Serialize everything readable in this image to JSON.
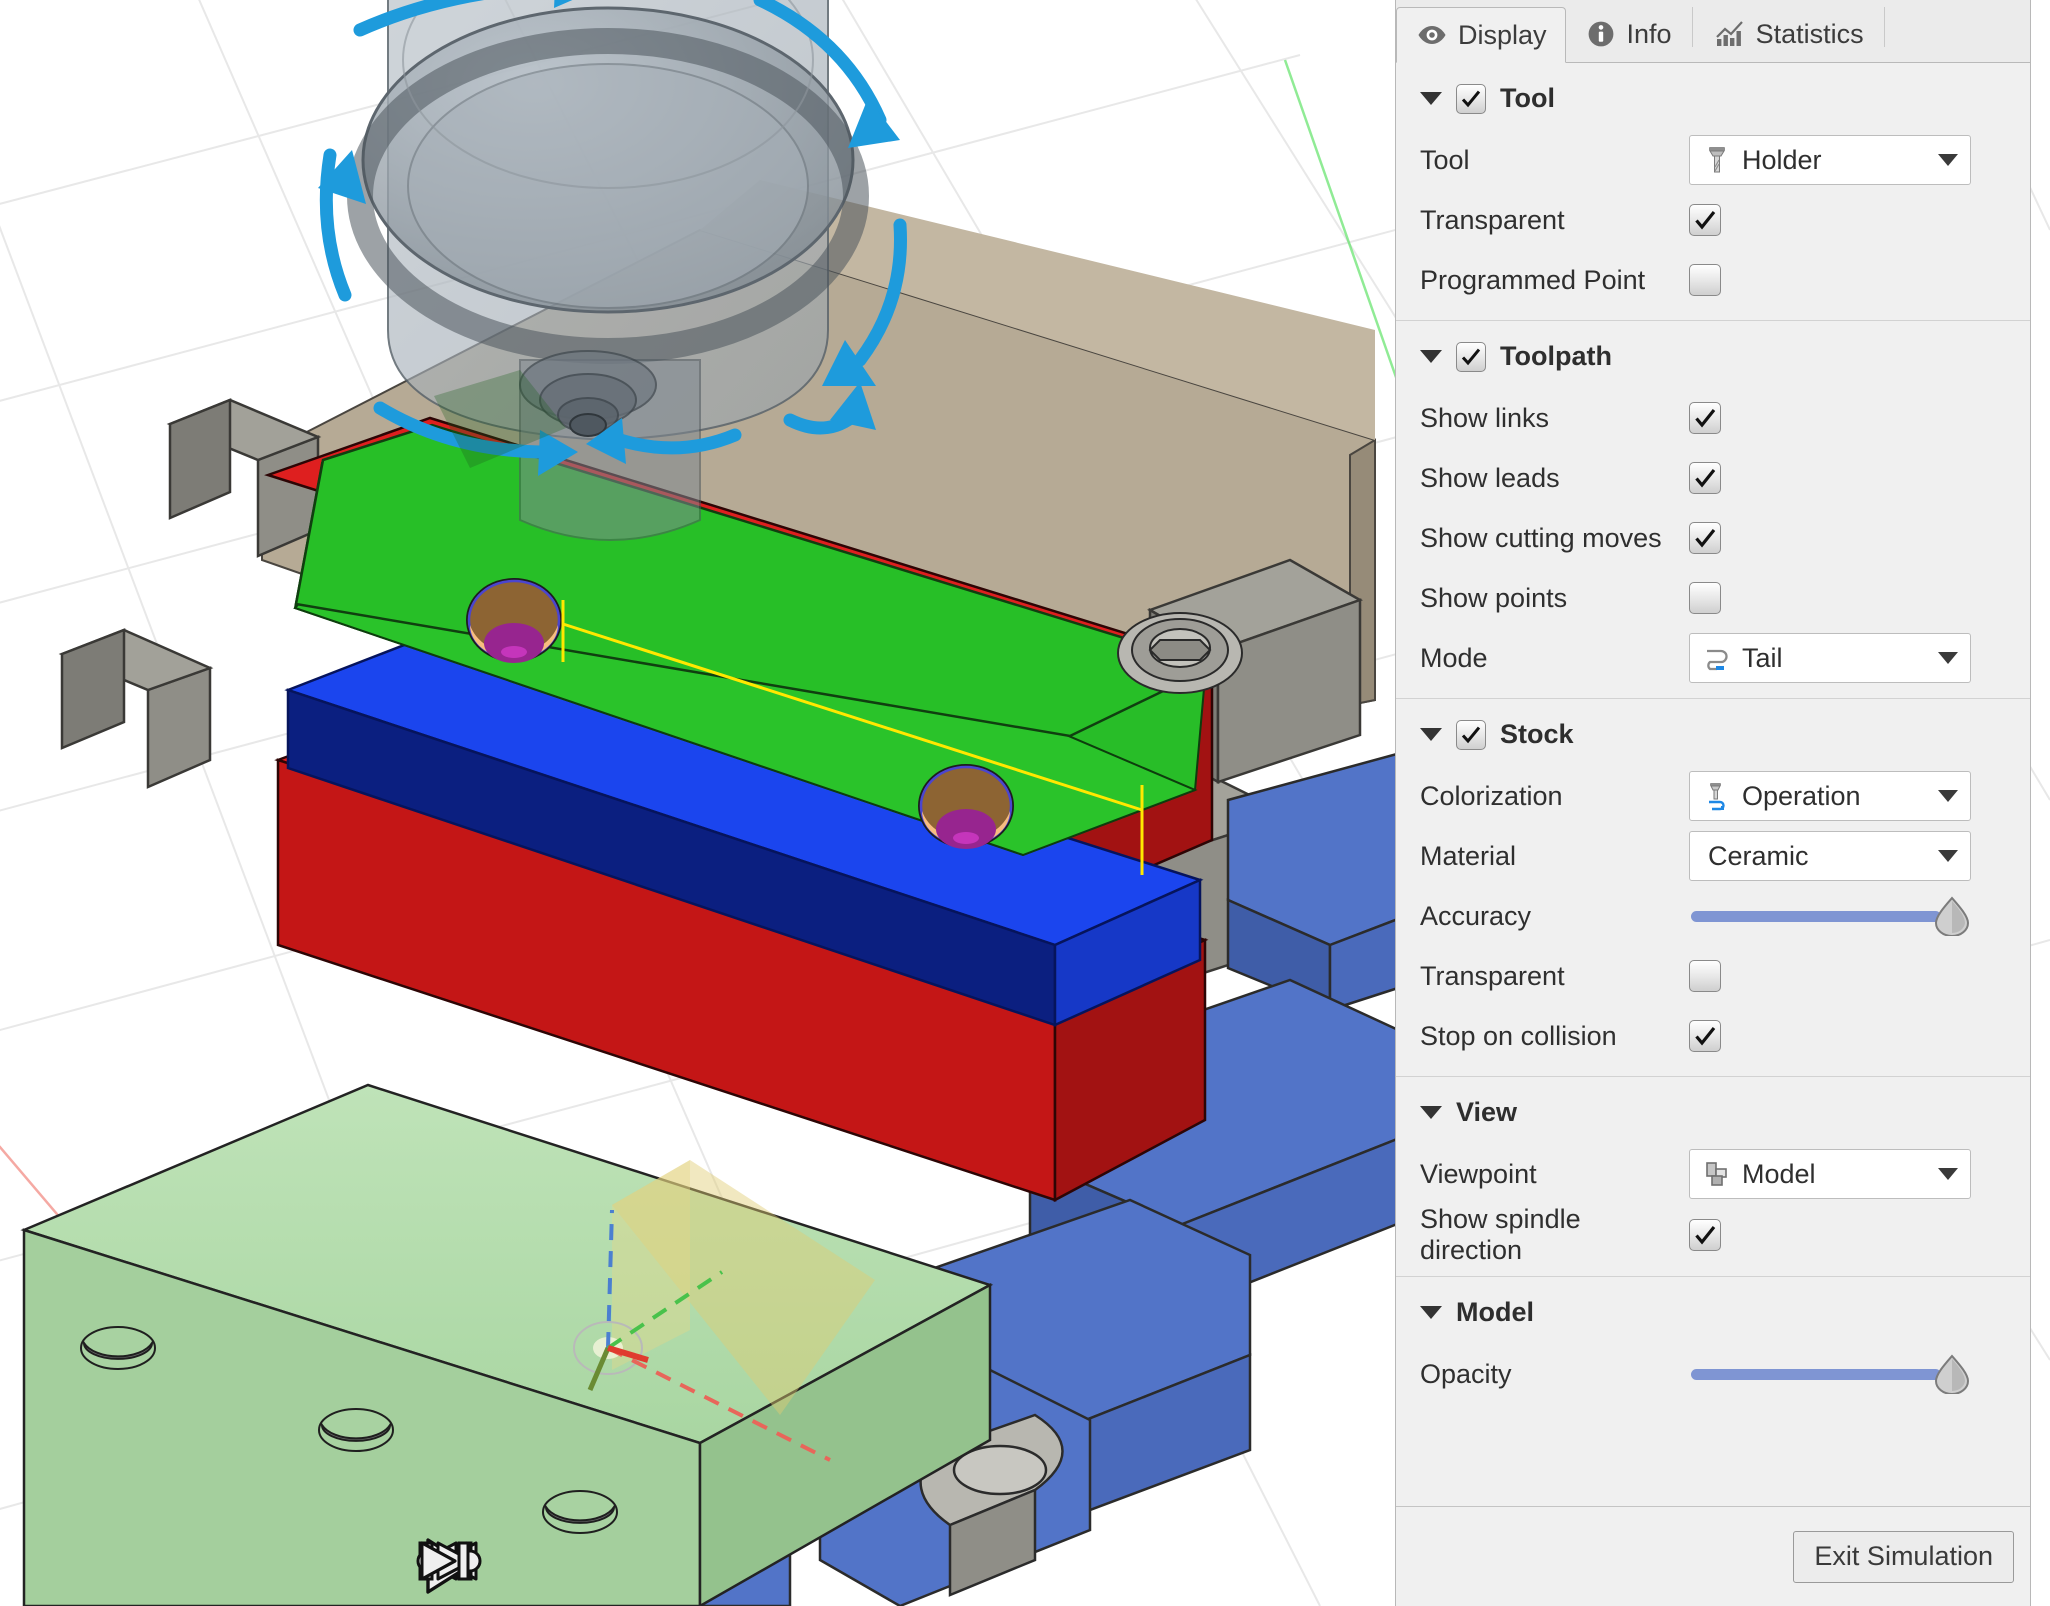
{
  "tabs": [
    {
      "label": "Display",
      "icon": "eye-icon",
      "active": true
    },
    {
      "label": "Info",
      "icon": "info-icon",
      "active": false
    },
    {
      "label": "Statistics",
      "icon": "chart-bar-icon",
      "active": false
    }
  ],
  "groups": {
    "tool": {
      "title": "Tool",
      "enabled": true,
      "rows": {
        "tool": {
          "label": "Tool",
          "value": "Holder",
          "icon": "tool-holder-icon"
        },
        "transparent": {
          "label": "Transparent",
          "checked": true
        },
        "programmed_point": {
          "label": "Programmed Point",
          "checked": false
        }
      }
    },
    "toolpath": {
      "title": "Toolpath",
      "enabled": true,
      "rows": {
        "show_links": {
          "label": "Show links",
          "checked": true
        },
        "show_leads": {
          "label": "Show leads",
          "checked": true
        },
        "show_cutting_moves": {
          "label": "Show cutting moves",
          "checked": true
        },
        "show_points": {
          "label": "Show points",
          "checked": false
        },
        "mode": {
          "label": "Mode",
          "value": "Tail",
          "icon": "toolpath-tail-icon"
        }
      }
    },
    "stock": {
      "title": "Stock",
      "enabled": true,
      "rows": {
        "colorization": {
          "label": "Colorization",
          "value": "Operation",
          "icon": "operation-icon"
        },
        "material": {
          "label": "Material",
          "value": "Ceramic",
          "icon": null
        },
        "accuracy": {
          "label": "Accuracy",
          "value": 100
        },
        "transparent": {
          "label": "Transparent",
          "checked": false
        },
        "stop_on_collision": {
          "label": "Stop on collision",
          "checked": true
        }
      }
    },
    "view": {
      "title": "View",
      "rows": {
        "viewpoint": {
          "label": "Viewpoint",
          "value": "Model",
          "icon": "viewpoint-model-icon"
        },
        "show_spindle_direction": {
          "label": "Show spindle direction",
          "checked": true
        }
      }
    },
    "model": {
      "title": "Model",
      "rows": {
        "opacity": {
          "label": "Opacity",
          "value": 100
        }
      }
    }
  },
  "footer": {
    "exit_label": "Exit Simulation"
  },
  "playback": [
    {
      "name": "skip-to-start-button",
      "icon": "skip-to-start-icon"
    },
    {
      "name": "step-back-point-button",
      "icon": "step-back-point-icon"
    },
    {
      "name": "step-backward-button",
      "icon": "step-backward-icon"
    },
    {
      "name": "play-button",
      "icon": "play-icon"
    },
    {
      "name": "step-forward-button",
      "icon": "step-forward-icon"
    },
    {
      "name": "step-forward-point-button",
      "icon": "step-forward-point-icon"
    },
    {
      "name": "skip-to-end-button",
      "icon": "skip-to-end-icon"
    }
  ],
  "viewport": {
    "colors": {
      "background": "#ffffff",
      "grid_line": "#e9e9e9",
      "stock_machined": "#21b521",
      "stock_red": "#e21b1b",
      "stock_blue": "#1535d8",
      "part_green": "#b6deb0",
      "fixture_blue": "#4f6fc4",
      "machine_gray": "#8d8c86",
      "table_tan": "#b4a893",
      "tool_holder": "#9aa3ab",
      "spindle_arrow": "#1e9bdc",
      "toolpath_yellow": "#ffe400",
      "hole_brown": "#9a6b3a",
      "hole_tan": "#f2b87a",
      "hole_purple": "#96228f",
      "axis_x": "#e03b2e",
      "axis_y": "#49c24b",
      "axis_z": "#4b7fd0"
    }
  }
}
